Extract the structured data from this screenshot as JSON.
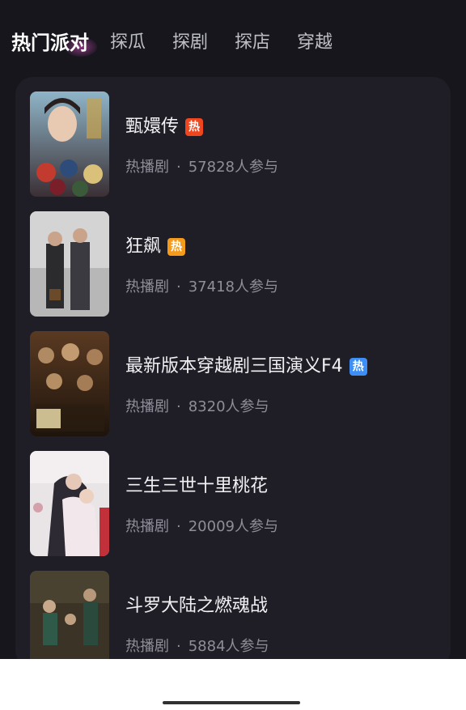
{
  "tabs": [
    {
      "label": "热门派对",
      "active": true
    },
    {
      "label": "探瓜",
      "active": false
    },
    {
      "label": "探剧",
      "active": false
    },
    {
      "label": "探店",
      "active": false
    },
    {
      "label": "穿越",
      "active": false
    }
  ],
  "items": [
    {
      "title": "甄嬛传",
      "badge": "热",
      "badge_color": "#f0461e",
      "category": "热播剧",
      "participants": "57828人参与"
    },
    {
      "title": "狂飙",
      "badge": "热",
      "badge_color": "#f59a1a",
      "category": "热播剧",
      "participants": "37418人参与"
    },
    {
      "title": "最新版本穿越剧三国演义F4",
      "badge": "热",
      "badge_color": "#3d8ef5",
      "category": "热播剧",
      "participants": "8320人参与"
    },
    {
      "title": "三生三世十里桃花",
      "badge": "",
      "category": "热播剧",
      "participants": "20009人参与"
    },
    {
      "title": "斗罗大陆之燃魂战",
      "badge": "",
      "category": "热播剧",
      "participants": "5884人参与"
    }
  ],
  "separator": "·",
  "colors": {
    "background": "#17161d",
    "card": "#1f1e26",
    "active_glow": "#d64ebe"
  }
}
